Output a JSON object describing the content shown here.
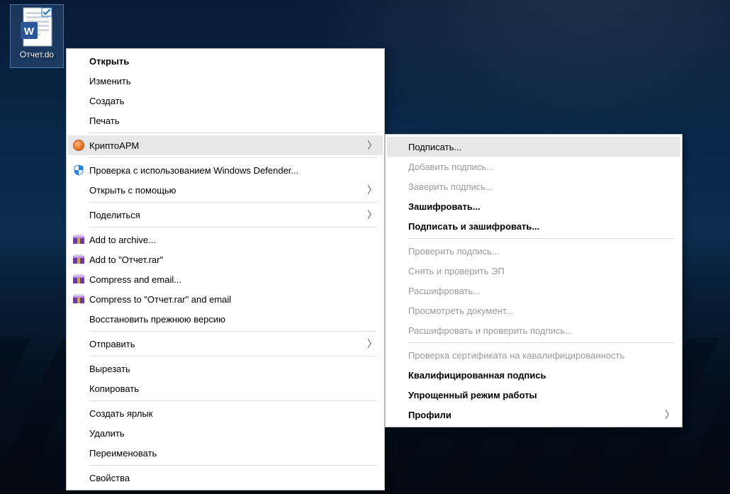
{
  "desktop": {
    "file_label": "Отчет.do"
  },
  "menu": {
    "open": "Открыть",
    "edit": "Изменить",
    "create": "Создать",
    "print": "Печать",
    "cryptoarm": "КриптоАРМ",
    "defender": "Проверка с использованием Windows Defender...",
    "open_with": "Открыть с помощью",
    "share": "Поделиться",
    "add_to_archive": "Add to archive...",
    "add_to_rar": "Add to \"Отчет.rar\"",
    "compress_email": "Compress and email...",
    "compress_to_rar_email": "Compress to \"Отчет.rar\" and email",
    "restore_prev": "Восстановить прежнюю версию",
    "send_to": "Отправить",
    "cut": "Вырезать",
    "copy": "Копировать",
    "create_shortcut": "Создать ярлык",
    "delete": "Удалить",
    "rename": "Переименовать",
    "properties": "Свойства"
  },
  "submenu": {
    "sign": "Подписать...",
    "add_signature": "Добавить подпись...",
    "certify_signature": "Заверить подпись...",
    "encrypt": "Зашифровать...",
    "sign_and_encrypt": "Подписать и зашифровать...",
    "verify_signature": "Проверить подпись...",
    "remove_and_verify": "Снять и проверить ЭП",
    "decrypt": "Расшифровать...",
    "view_document": "Просмотреть документ...",
    "decrypt_and_verify": "Расшифровать и проверить подпись...",
    "cert_check": "Проверка сертификата на кавалифицированность",
    "qualified_signature": "Квалифицированная подпись",
    "simple_mode": "Упрощенный режим работы",
    "profiles": "Профили"
  }
}
